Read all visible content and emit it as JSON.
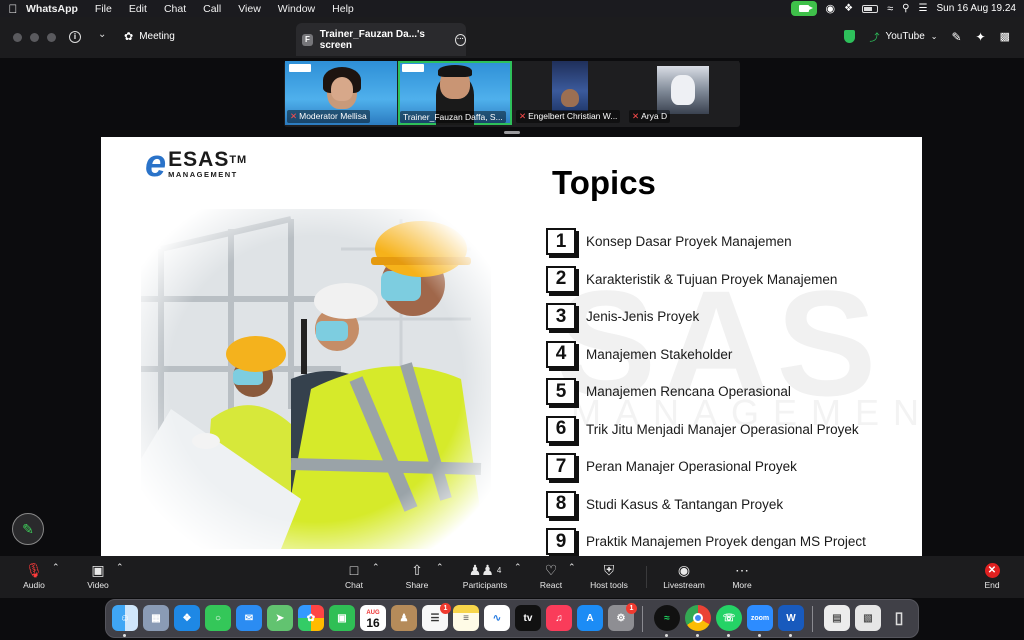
{
  "menubar": {
    "app": "WhatsApp",
    "items": [
      "File",
      "Edit",
      "Chat",
      "Call",
      "View",
      "Window",
      "Help"
    ],
    "datetime": "Sun 16 Aug  19.24"
  },
  "toolbar": {
    "meeting_label": "Meeting",
    "share_tab_title": "Trainer_Fauzan Da...'s screen",
    "youtube_label": "YouTube"
  },
  "participants": [
    {
      "name": "Moderator Mellisa"
    },
    {
      "name": "Trainer_Fauzan Daffa, S..."
    },
    {
      "name": "Engelbert Christian W..."
    },
    {
      "name": "Arya D"
    }
  ],
  "slide": {
    "logo_brand": "ESAS",
    "logo_tm": "TM",
    "logo_sub": "MANAGEMENT",
    "watermark": "SAS",
    "watermark_sub": "MANAGEMENT",
    "title": "Topics",
    "topics": [
      {
        "num": "1",
        "text": "Konsep Dasar Proyek Manajemen"
      },
      {
        "num": "2",
        "text": "Karakteristik & Tujuan Proyek Manajemen"
      },
      {
        "num": "3",
        "text": "Jenis-Jenis Proyek"
      },
      {
        "num": "4",
        "text": "Manajemen Stakeholder"
      },
      {
        "num": "5",
        "text": "Manajemen Rencana Operasional"
      },
      {
        "num": "6",
        "text": "Trik Jitu Menjadi Manajer Operasional Proyek"
      },
      {
        "num": "7",
        "text": "Peran Manajer Operasional Proyek"
      },
      {
        "num": "8",
        "text": "Studi Kasus & Tantangan Proyek"
      },
      {
        "num": "9",
        "text": "Praktik Manajemen Proyek dengan MS Project"
      }
    ]
  },
  "bottombar": {
    "audio": "Audio",
    "video": "Video",
    "chat": "Chat",
    "share": "Share",
    "participants": "Participants",
    "participants_count": "4",
    "react": "React",
    "host_tools": "Host tools",
    "livestream": "Livestream",
    "more": "More",
    "end": "End"
  },
  "dock": {
    "calendar_month": "AUG",
    "calendar_day": "16",
    "reminders_badge": "1",
    "settings_badge": "1",
    "tv_label": "tv",
    "zoom_label": "zoom",
    "word_label": "W"
  },
  "colors": {
    "accent_green": "#2ec05b",
    "end_red": "#e02020",
    "logo_blue": "#2a73c9"
  }
}
